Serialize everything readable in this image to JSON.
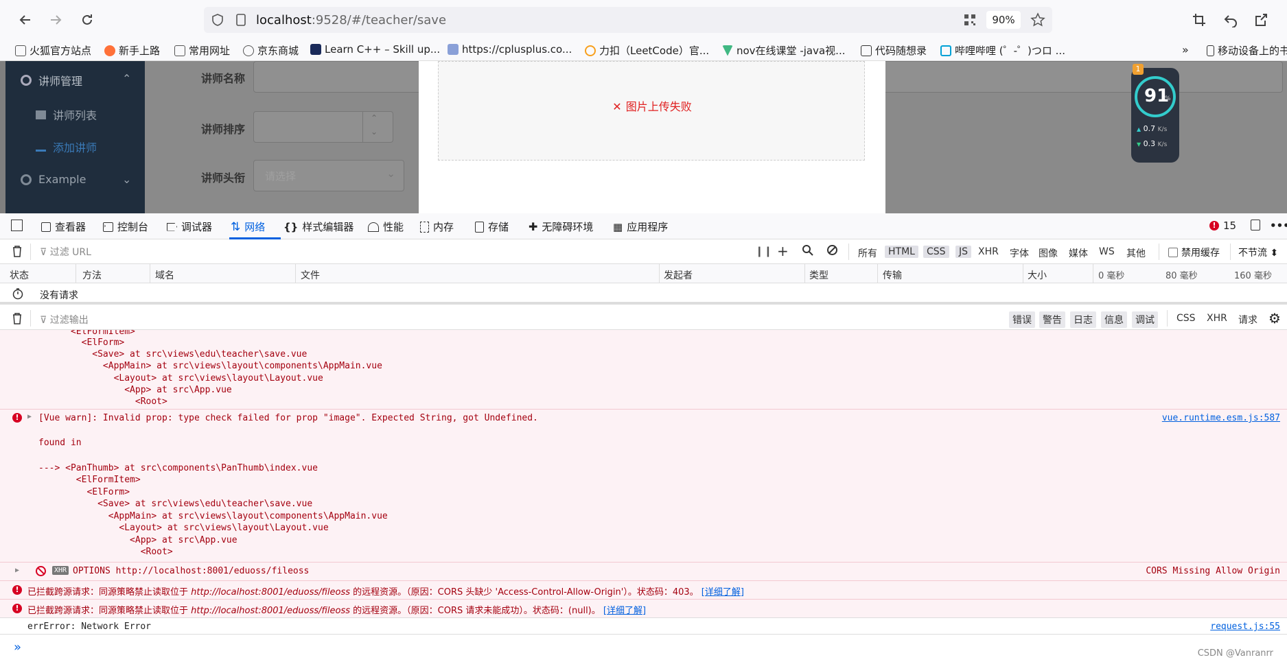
{
  "browser": {
    "url_host": "localhost",
    "url_rest": ":9528/#/teacher/save",
    "zoom": "90%"
  },
  "bookmarks": [
    "火狐官方站点",
    "新手上路",
    "常用网址",
    "京东商城",
    "Learn C++ – Skill up...",
    "https://cplusplus.co...",
    "力扣（LeetCode）官...",
    "nov在线课堂 -java视...",
    "代码随想录",
    "哔哩哔哩 (゜-゜)つロ ...",
    "移动设备上的书"
  ],
  "widget": {
    "badge": "1",
    "score": "91",
    "pct": "%",
    "up": "0.7",
    "down": "0.3",
    "unit": "K/s"
  },
  "sidebar": {
    "group": "讲师管理",
    "item1": "讲师列表",
    "item2": "添加讲师",
    "group2": "Example"
  },
  "form": {
    "name_label": "讲师名称",
    "sort_label": "讲师排序",
    "level_label": "讲师头衔",
    "level_placeholder": "请选择"
  },
  "upload": {
    "error": "图片上传失败"
  },
  "devtools": {
    "tabs": [
      "查看器",
      "控制台",
      "调试器",
      "网络",
      "样式编辑器",
      "性能",
      "内存",
      "存储",
      "无障碍环境",
      "应用程序"
    ],
    "error_count": "15",
    "filter_url": "过滤 URL",
    "filters": [
      "所有",
      "HTML",
      "CSS",
      "JS",
      "XHR",
      "字体",
      "图像",
      "媒体",
      "WS",
      "其他"
    ],
    "disable_cache": "禁用缓存",
    "throttle": "不节流 ⬍",
    "columns": [
      "状态",
      "方法",
      "域名",
      "文件",
      "发起者",
      "类型",
      "传输",
      "大小",
      "0 毫秒",
      "80 毫秒",
      "160 毫秒"
    ],
    "no_requests": "没有请求",
    "filter_output": "过滤输出",
    "levels": [
      "错误",
      "警告",
      "日志",
      "信息",
      "调试"
    ],
    "extra": [
      "CSS",
      "XHR",
      "请求"
    ]
  },
  "console": {
    "trace1": [
      "      <ElFormItem>",
      "        <ElForm>",
      "          <Save> at src\\views\\edu\\teacher\\save.vue",
      "            <AppMain> at src\\views\\layout\\components\\AppMain.vue",
      "              <Layout> at src\\views\\layout\\Layout.vue",
      "                <App> at src\\App.vue",
      "                  <Root>"
    ],
    "warn_msg": "[Vue warn]: Invalid prop: type check failed for prop \"image\". Expected String, got Undefined.",
    "warn_src": "vue.runtime.esm.js:587",
    "found_in": "found in",
    "trace2": [
      "---> <PanThumb> at src\\components\\PanThumb\\index.vue",
      "       <ElFormItem>",
      "         <ElForm>",
      "           <Save> at src\\views\\edu\\teacher\\save.vue",
      "             <AppMain> at src\\views\\layout\\components\\AppMain.vue",
      "               <Layout> at src\\views\\layout\\Layout.vue",
      "                 <App> at src\\App.vue",
      "                   <Root>"
    ],
    "xhr_tag": "XHR",
    "xhr_line": "OPTIONS http://localhost:8001/eduoss/fileoss",
    "xhr_src": "CORS Missing Allow Origin",
    "cors1_a": "已拦截跨源请求：同源策略禁止读取位于 ",
    "cors1_url": "http://localhost:8001/eduoss/fileoss",
    "cors1_b": " 的远程资源。（原因：CORS 头缺少 'Access-Control-Allow-Origin'）。状态码：403。",
    "cors2_b": " 的远程资源。（原因：CORS 请求未能成功）。状态码：(null)。",
    "learn_more": "[详细了解]",
    "err_line": "errError: Network Error",
    "err_src": "request.js:55",
    "watermark": "CSDN @Vanranrr"
  }
}
